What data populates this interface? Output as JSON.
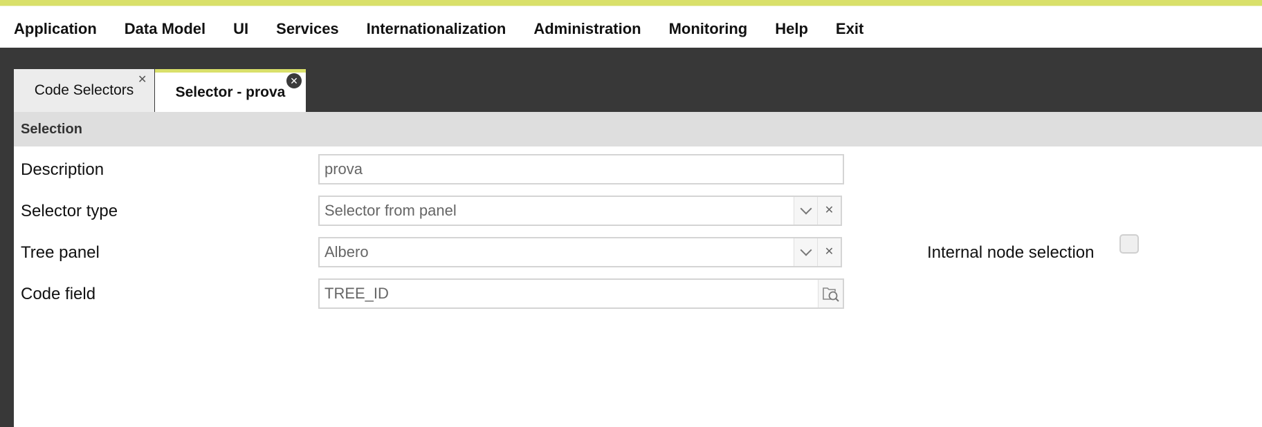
{
  "menu": {
    "items": [
      {
        "label": "Application"
      },
      {
        "label": "Data Model"
      },
      {
        "label": "UI"
      },
      {
        "label": "Services"
      },
      {
        "label": "Internationalization"
      },
      {
        "label": "Administration"
      },
      {
        "label": "Monitoring"
      },
      {
        "label": "Help"
      },
      {
        "label": "Exit"
      }
    ]
  },
  "tabs": [
    {
      "label": "Code Selectors",
      "close_icon": "close-icon"
    },
    {
      "label": "Selector - prova",
      "close_icon": "close-circle-icon",
      "active": true
    }
  ],
  "section": {
    "title": "Selection"
  },
  "form": {
    "description": {
      "label": "Description",
      "value": "prova"
    },
    "selector_type": {
      "label": "Selector type",
      "value": "Selector from panel"
    },
    "tree_panel": {
      "label": "Tree panel",
      "value": "Albero"
    },
    "code_field": {
      "label": "Code field",
      "value": "TREE_ID"
    },
    "internal_node_selection": {
      "label": "Internal node selection",
      "checked": false
    }
  },
  "colors": {
    "accent": "#d9e06a",
    "workspace_bg": "#383838",
    "section_header_bg": "#dedede"
  }
}
